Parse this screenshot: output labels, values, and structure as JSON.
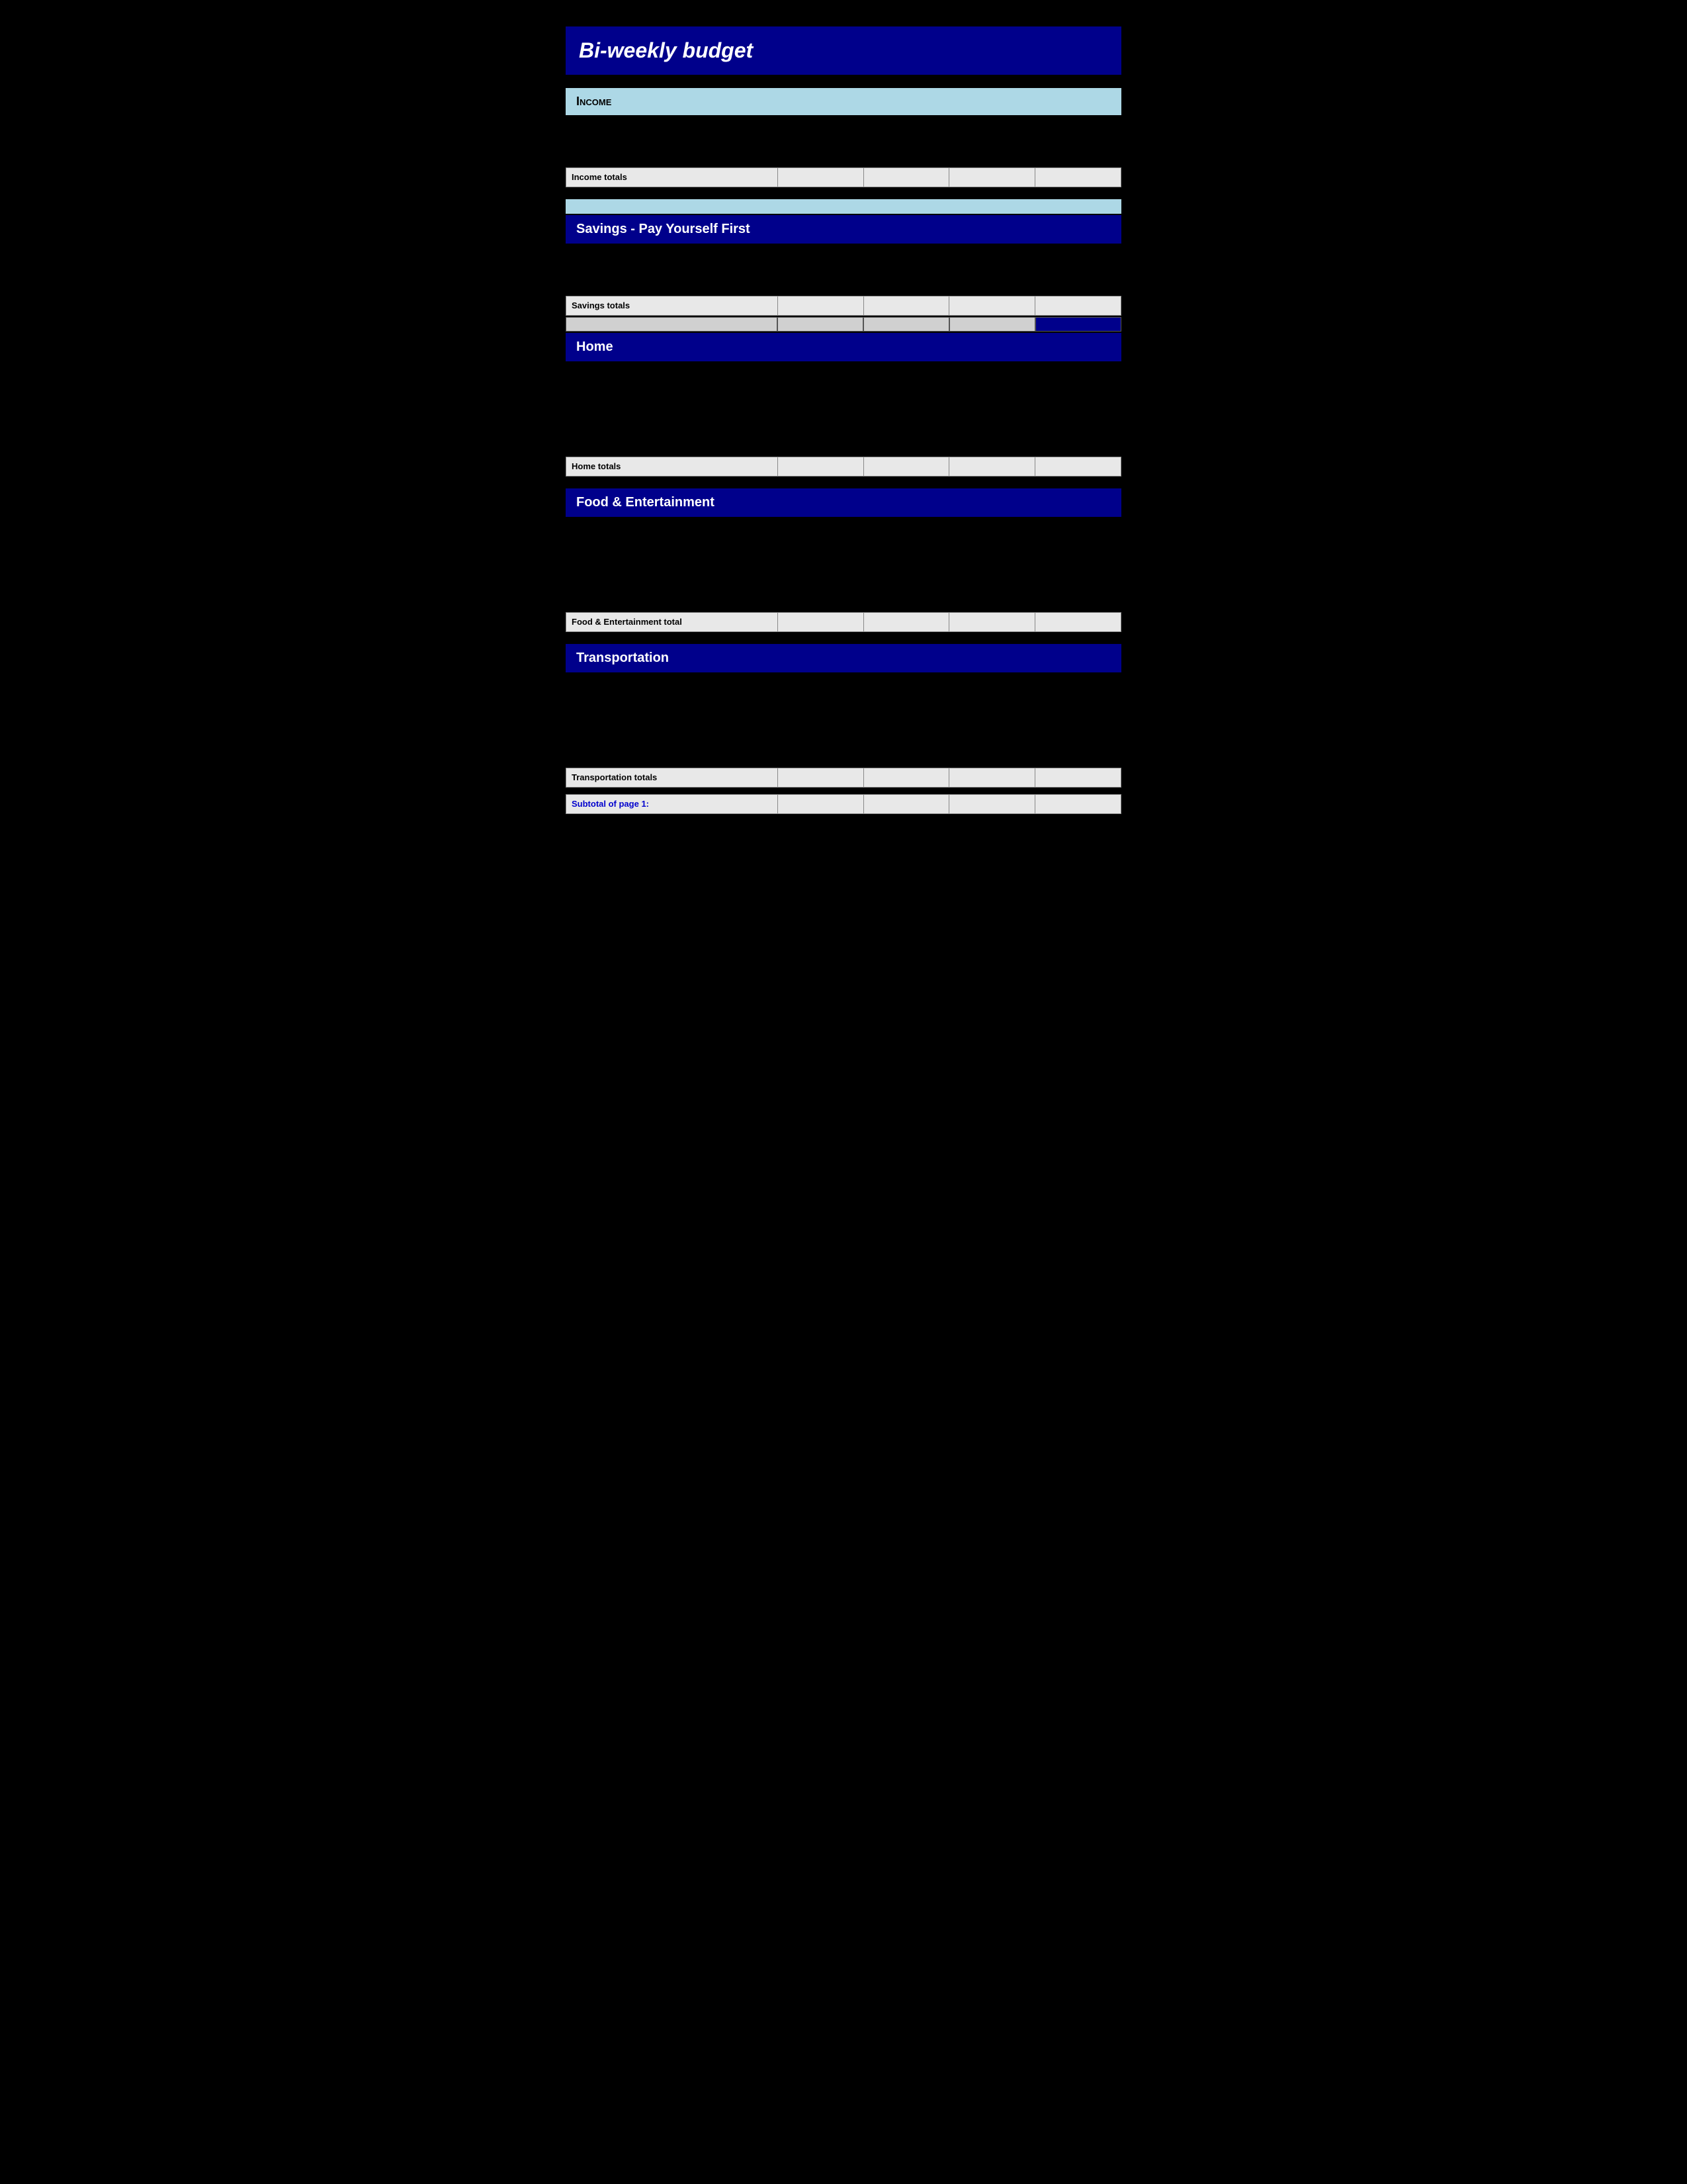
{
  "page": {
    "title": "Bi-weekly  budget",
    "sections": [
      {
        "id": "income",
        "header_text": "Income",
        "header_style": "light",
        "totals_label": "Income totals"
      },
      {
        "id": "savings",
        "header_text": "Savings - Pay Yourself First",
        "header_style": "dark",
        "totals_label": "Savings totals"
      },
      {
        "id": "home",
        "header_text": "Home",
        "header_style": "dark",
        "totals_label": "Home totals"
      },
      {
        "id": "food",
        "header_text": "Food & Entertainment",
        "header_style": "dark",
        "totals_label": "Food & Entertainment total"
      },
      {
        "id": "transportation",
        "header_text": "Transportation",
        "header_style": "dark",
        "totals_label": "Transportation totals"
      }
    ],
    "subtotal_label": "Subtotal of page 1:"
  }
}
